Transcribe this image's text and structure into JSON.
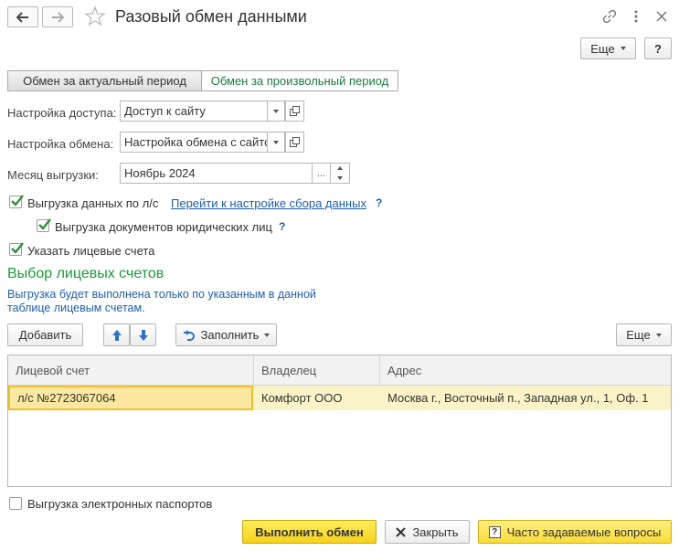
{
  "window": {
    "title": "Разовый обмен данными",
    "more_label": "Еще",
    "help_label": "?"
  },
  "tabs": [
    {
      "label": "Обмен за актуальный период",
      "active": false
    },
    {
      "label": "Обмен за произвольный период",
      "active": true
    }
  ],
  "form": {
    "access_label": "Настройка доступа:",
    "access_value": "Доступ к сайту",
    "exchange_label": "Настройка обмена:",
    "exchange_value": "Настройка обмена с сайто",
    "month_label": "Месяц выгрузки:",
    "month_value": "Ноябрь 2024",
    "month_dots": "..."
  },
  "checkboxes": {
    "export_by_accounts": {
      "label": "Выгрузка данных по л/с",
      "checked": true
    },
    "collection_link": "Перейти к настройке сбора данных",
    "legal_docs": {
      "label": "Выгрузка документов юридических лиц",
      "checked": true
    },
    "specify_accounts": {
      "label": "Указать лицевые счета",
      "checked": true
    },
    "passports": {
      "label": "Выгрузка электронных паспортов",
      "checked": false
    }
  },
  "accounts_section": {
    "title": "Выбор лицевых счетов",
    "hint": "Выгрузка будет выполнена только по указанным в данной таблице лицевым счетам."
  },
  "table_toolbar": {
    "add_label": "Добавить",
    "fill_label": "Заполнить",
    "more_label": "Еще"
  },
  "table": {
    "columns": [
      "Лицевой счет",
      "Владелец",
      "Адрес"
    ],
    "rows": [
      [
        "л/с №2723067064",
        "Комфорт ООО",
        "Москва г., Восточный п., Западная ул., 1, Оф. 1"
      ]
    ]
  },
  "footer": {
    "run_label": "Выполнить обмен",
    "close_label": "Закрыть",
    "faq_label": "Часто задаваемые вопросы"
  },
  "colors": {
    "accent_green": "#1c9a3c",
    "link_blue": "#1f5fa8",
    "primary_yellow": "#f5d21a",
    "row_highlight": "#fbf3c8"
  }
}
